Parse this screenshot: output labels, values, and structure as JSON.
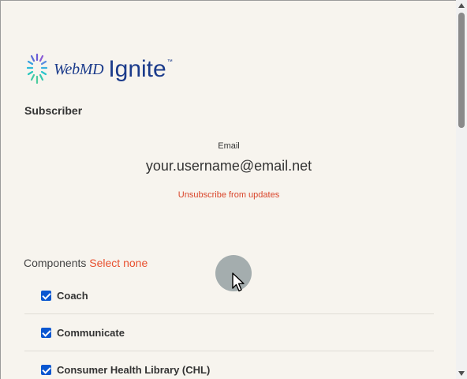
{
  "logo": {
    "webmd": "WebMD",
    "ignite": "Ignite",
    "tm": "™",
    "icon": "webmd-ignite-burst-icon"
  },
  "subscriber": {
    "heading": "Subscriber",
    "email_label": "Email",
    "email_value": "your.username@email.net",
    "unsubscribe_label": "Unsubscribe from updates"
  },
  "components": {
    "heading": "Components",
    "select_none_label": "Select none",
    "items": [
      {
        "label": "Coach",
        "checked": true
      },
      {
        "label": "Communicate",
        "checked": true
      },
      {
        "label": "Consumer Health Library (CHL)",
        "checked": true
      }
    ]
  },
  "colors": {
    "background": "#f7f4ee",
    "brand_blue": "#1b3b8b",
    "link_red": "#d9452a",
    "checkbox_blue": "#0b57d0"
  }
}
